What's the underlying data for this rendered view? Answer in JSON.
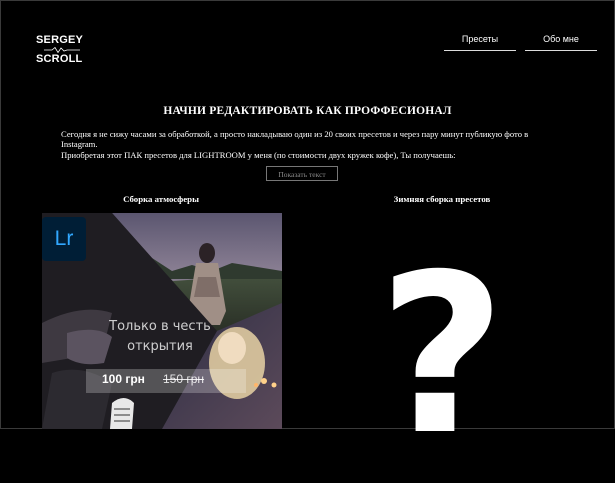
{
  "logo": {
    "line1": "SERGEY",
    "line2": "SCROLL"
  },
  "nav": {
    "presets": "Пресеты",
    "about": "Обо мне"
  },
  "headline": "НАЧНИ РЕДАКТИРОВАТЬ КАК ПРОФФЕСИОНАЛ",
  "intro": {
    "p1": "Сегодня я не сижу часами за обработкой, а просто накладываю один из 20 своих пресетов и через пару минут публикую фото в Instagram.",
    "p2": "Приобретая этот ПАК пресетов для LIGHTROOM у меня (по стоимости двух кружек кофе), Ты получаешь:"
  },
  "show_text_button": "Показать текст",
  "products": [
    {
      "title": "Сборка атмосферы",
      "badge": "Lr",
      "overlay_line1": "Только в честь",
      "overlay_line2": "открытия",
      "price_new": "100 грн",
      "price_old": "150 грн"
    },
    {
      "title": "Зимняя сборка пресетов",
      "symbol": "?"
    }
  ],
  "colors": {
    "background": "#000000",
    "lightroom_badge": "#001e36",
    "lightroom_text": "#31a8ff"
  }
}
